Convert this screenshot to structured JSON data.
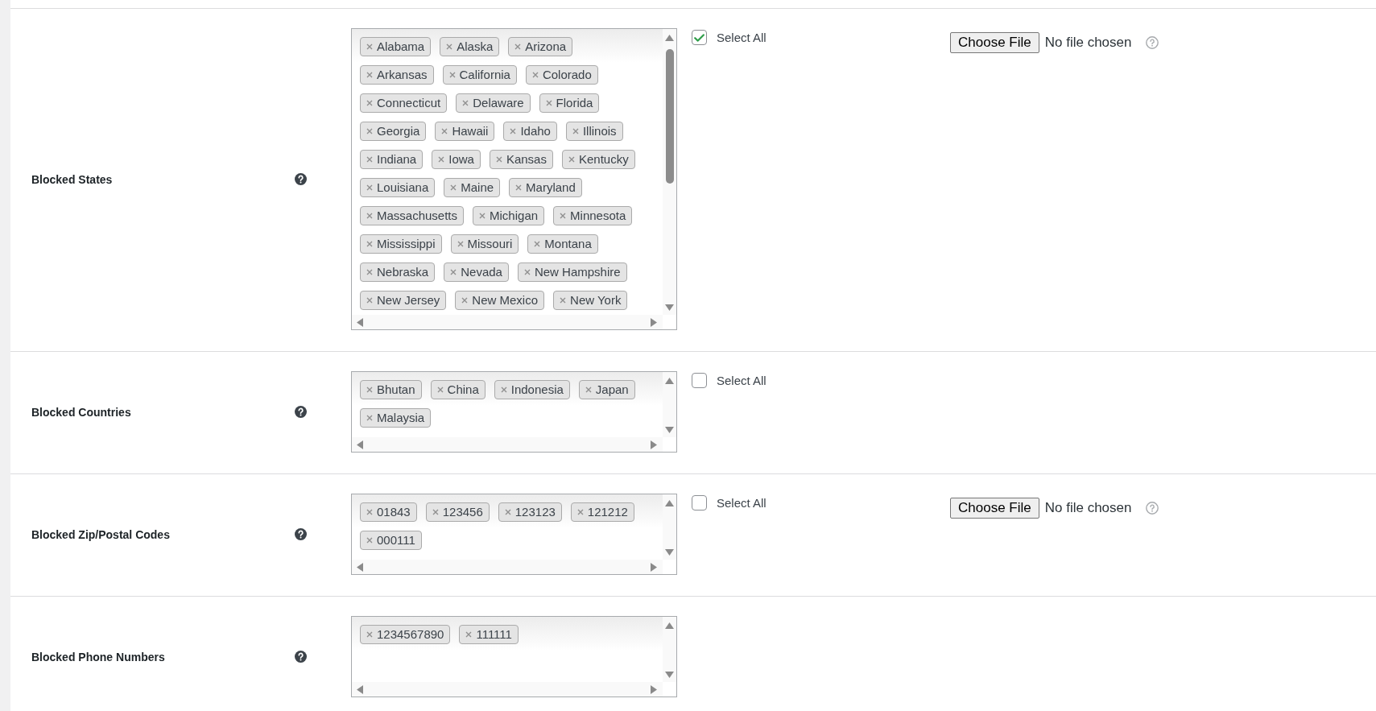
{
  "settings": [
    {
      "label": "Blocked States",
      "tags": [
        "Alabama",
        "Alaska",
        "Arizona",
        "Arkansas",
        "California",
        "Colorado",
        "Connecticut",
        "Delaware",
        "Florida",
        "Georgia",
        "Hawaii",
        "Idaho",
        "Illinois",
        "Indiana",
        "Iowa",
        "Kansas",
        "Kentucky",
        "Louisiana",
        "Maine",
        "Maryland",
        "Massachusetts",
        "Michigan",
        "Minnesota",
        "Mississippi",
        "Missouri",
        "Montana",
        "Nebraska",
        "Nevada",
        "New Hampshire",
        "New Jersey",
        "New Mexico",
        "New York"
      ],
      "select_all": {
        "label": "Select All",
        "checked": true
      },
      "file_input": {
        "button": "Choose File",
        "status": "No file chosen"
      }
    },
    {
      "label": "Blocked Countries",
      "tags": [
        "Bhutan",
        "China",
        "Indonesia",
        "Japan",
        "Malaysia"
      ],
      "select_all": {
        "label": "Select All",
        "checked": false
      }
    },
    {
      "label": "Blocked Zip/Postal Codes",
      "tags": [
        "01843",
        "123456",
        "123123",
        "121212",
        "000111"
      ],
      "select_all": {
        "label": "Select All",
        "checked": false
      },
      "file_input": {
        "button": "Choose File",
        "status": "No file chosen"
      }
    },
    {
      "label": "Blocked Phone Numbers",
      "tags": [
        "1234567890",
        "111111"
      ]
    }
  ]
}
